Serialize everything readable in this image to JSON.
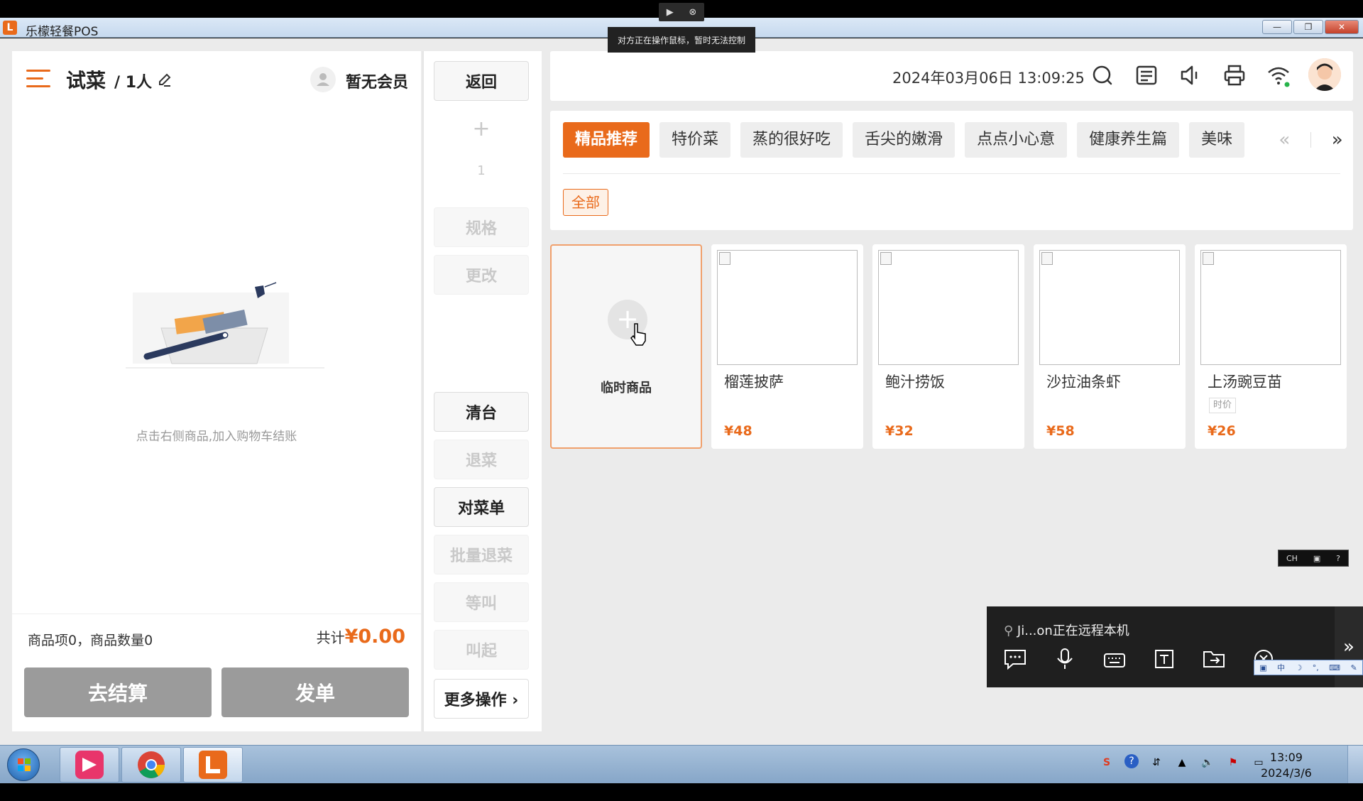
{
  "remote": {
    "tip": "对方正在操作鼠标，暂时无法控制",
    "session_user": "Ji...on正在远程本机",
    "ime_mini": "CH"
  },
  "window": {
    "title": "乐檬轻餐POS",
    "logo_letter": "L"
  },
  "cart": {
    "table_name": "试菜",
    "guest_count": "/ 1人",
    "member_label": "暂无会员",
    "empty_text": "点击右侧商品,加入购物车结账",
    "summary_items": "商品项0，商品数量0",
    "total_label": "共计",
    "total_amount": "¥0.00",
    "checkout_label": "去结算",
    "send_label": "发单"
  },
  "ops": {
    "back": "返回",
    "plus": "+",
    "qty": "1",
    "spec": "规格",
    "modify": "更改",
    "clear": "清台",
    "return_dish": "退菜",
    "check_menu": "对菜单",
    "batch_return": "批量退菜",
    "wait_call": "等叫",
    "call_up": "叫起",
    "more": "更多操作 ›"
  },
  "infobar": {
    "datetime": "2024年03月06日 13:09:25",
    "icons": [
      "search-icon",
      "list-icon",
      "speaker-icon",
      "printer-icon",
      "wifi-icon"
    ]
  },
  "categories": {
    "tabs": [
      "精品推荐",
      "特价菜",
      "蒸的很好吃",
      "舌尖的嫩滑",
      "点点小心意",
      "健康养生篇",
      "美味"
    ],
    "active_index": 0,
    "prev": "«",
    "next": "»",
    "subtab": "全部"
  },
  "products": {
    "temp_label": "临时商品",
    "items": [
      {
        "name": "榴莲披萨",
        "price": "¥48",
        "tag": ""
      },
      {
        "name": "鲍汁捞饭",
        "price": "¥32",
        "tag": ""
      },
      {
        "name": "沙拉油条虾",
        "price": "¥58",
        "tag": ""
      },
      {
        "name": "上汤豌豆苗",
        "price": "¥26",
        "tag": "时价"
      }
    ]
  },
  "taskbar": {
    "time": "13:09",
    "date": "2024/3/6"
  },
  "colors": {
    "accent": "#e96a1b",
    "disabled_btn": "#9b9b9b"
  }
}
